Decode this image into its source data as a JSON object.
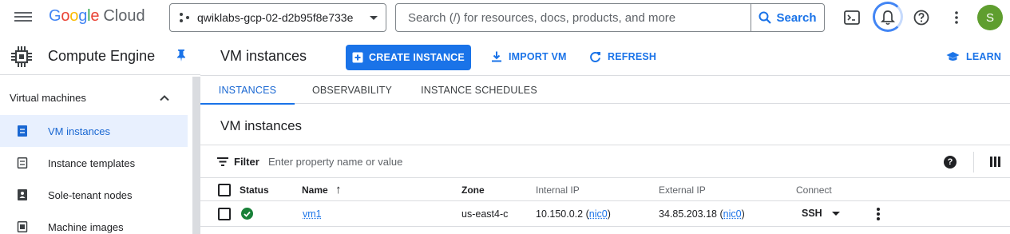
{
  "topbar": {
    "logo_brand_letters": [
      "G",
      "o",
      "o",
      "g",
      "l",
      "e"
    ],
    "logo_product": "Cloud",
    "project_name": "qwiklabs-gcp-02-d2b95f8e733e",
    "search_placeholder": "Search (/) for resources, docs, products, and more",
    "search_button": "Search",
    "avatar_initial": "S"
  },
  "sidebar": {
    "product_title": "Compute Engine",
    "section_label": "Virtual machines",
    "items": [
      {
        "label": "VM instances",
        "icon": "vm-instances-icon",
        "active": true
      },
      {
        "label": "Instance templates",
        "icon": "instance-templates-icon",
        "active": false
      },
      {
        "label": "Sole-tenant nodes",
        "icon": "sole-tenant-nodes-icon",
        "active": false
      },
      {
        "label": "Machine images",
        "icon": "machine-images-icon",
        "active": false
      }
    ]
  },
  "header": {
    "title": "VM instances",
    "create_instance": "CREATE INSTANCE",
    "import_vm": "IMPORT VM",
    "refresh": "REFRESH",
    "learn": "LEARN"
  },
  "tabs": [
    {
      "label": "INSTANCES",
      "active": true
    },
    {
      "label": "OBSERVABILITY",
      "active": false
    },
    {
      "label": "INSTANCE SCHEDULES",
      "active": false
    }
  ],
  "content": {
    "section_title": "VM instances",
    "filter_label": "Filter",
    "filter_placeholder": "Enter property name or value",
    "help_glyph": "?"
  },
  "table": {
    "columns": {
      "status": "Status",
      "name": "Name",
      "zone": "Zone",
      "internal_ip": "Internal IP",
      "external_ip": "External IP",
      "connect": "Connect"
    },
    "sort_indicator": "↑",
    "rows": [
      {
        "status": "running",
        "name": "vm1",
        "zone": "us-east4-c",
        "internal_ip": "10.150.0.2",
        "internal_nic": "nic0",
        "external_ip": "34.85.203.18",
        "external_nic": "nic0",
        "connect": "SSH"
      }
    ],
    "open_paren": "(",
    "close_paren": ")"
  },
  "colors": {
    "accent": "#1a73e8",
    "active_nav_bg": "#e8f0fe",
    "status_ok": "#188038",
    "avatar_bg": "#5f9e2f"
  }
}
